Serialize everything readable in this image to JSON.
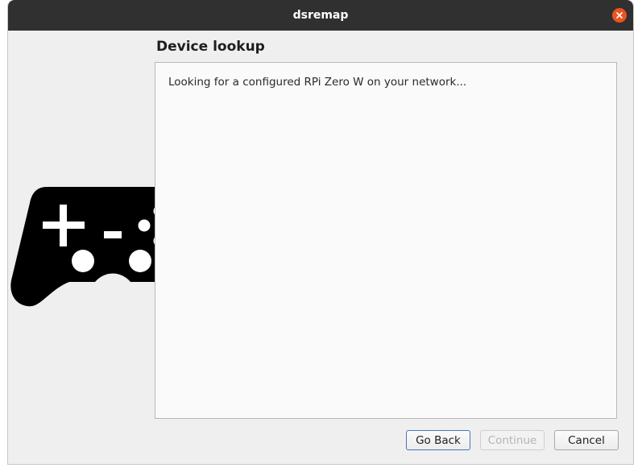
{
  "window": {
    "title": "dsremap"
  },
  "page": {
    "heading": "Device lookup",
    "status_text": "Looking for a configured RPi Zero W on your network..."
  },
  "buttons": {
    "back_label": "Go Back",
    "continue_label": "Continue",
    "cancel_label": "Cancel"
  },
  "icons": {
    "close": "close-icon",
    "gamepad": "gamepad-icon"
  },
  "colors": {
    "titlebar": "#303030",
    "close_button": "#e95420",
    "gamepad_dark": "#000000",
    "gamepad_light": "#9a9a9a"
  }
}
